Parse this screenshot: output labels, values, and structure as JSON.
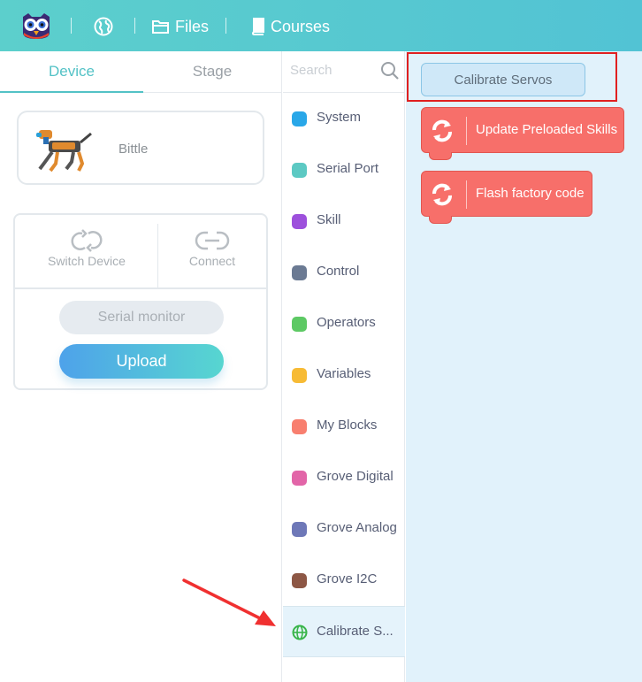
{
  "header": {
    "files_label": "Files",
    "courses_label": "Courses"
  },
  "left_panel": {
    "tabs": [
      {
        "label": "Device",
        "active": true
      },
      {
        "label": "Stage",
        "active": false
      }
    ],
    "device": {
      "name": "Bittle"
    },
    "controls": {
      "switch_label": "Switch Device",
      "connect_label": "Connect",
      "serial_label": "Serial monitor",
      "upload_label": "Upload"
    }
  },
  "category_panel": {
    "search_placeholder": "Search",
    "categories": [
      {
        "label": "System",
        "color": "#29a7e8"
      },
      {
        "label": "Serial Port",
        "color": "#5cc9c3"
      },
      {
        "label": "Skill",
        "color": "#9d50dc"
      },
      {
        "label": "Control",
        "color": "#6b7a93"
      },
      {
        "label": "Operators",
        "color": "#5dc964"
      },
      {
        "label": "Variables",
        "color": "#f7bb35"
      },
      {
        "label": "My Blocks",
        "color": "#f87f6f"
      },
      {
        "label": "Grove Digital",
        "color": "#e265a8"
      },
      {
        "label": "Grove Analog",
        "color": "#6e78b8"
      },
      {
        "label": "Grove I2C",
        "color": "#8d5745"
      },
      {
        "label": "Calibrate S...",
        "color": "#39b54a",
        "icon": "globe-icon",
        "selected": true
      }
    ]
  },
  "blocks_panel": {
    "calibrate_button": "Calibrate Servos",
    "blocks": [
      {
        "label": "Update Preloaded Skills",
        "color": "#f76f6a",
        "icon": "refresh-icon"
      },
      {
        "label": "Flash factory code",
        "color": "#f76f6a",
        "icon": "refresh-icon"
      }
    ]
  },
  "annotation": {
    "highlight_color": "#e02020",
    "arrow_color": "#f03030"
  }
}
